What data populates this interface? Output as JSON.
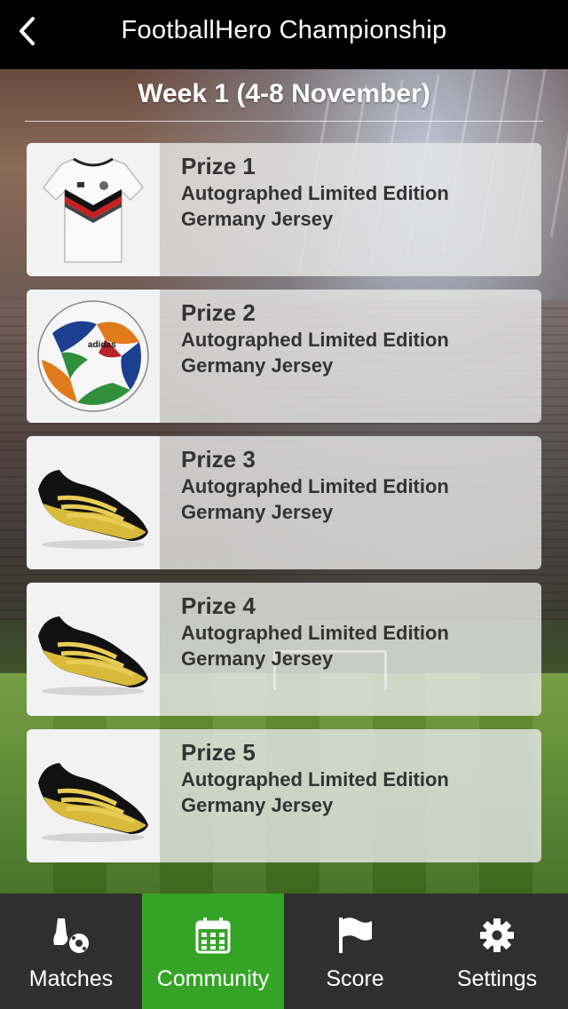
{
  "header": {
    "title": "FootballHero Championship",
    "back_icon": "chevron-left-icon"
  },
  "week": {
    "title": "Week 1 (4-8 November)"
  },
  "prizes": [
    {
      "name": "Prize 1",
      "description": "Autographed Limited Edition Germany Jersey",
      "image": "jersey"
    },
    {
      "name": "Prize 2",
      "description": "Autographed Limited Edition Germany Jersey",
      "image": "football"
    },
    {
      "name": "Prize 3",
      "description": "Autographed Limited Edition Germany Jersey",
      "image": "boot"
    },
    {
      "name": "Prize 4",
      "description": "Autographed Limited Edition Germany Jersey",
      "image": "boot"
    },
    {
      "name": "Prize 5",
      "description": "Autographed Limited Edition Germany Jersey",
      "image": "boot"
    }
  ],
  "tabs": [
    {
      "label": "Matches",
      "icon": "boot-ball-icon",
      "active": false
    },
    {
      "label": "Community",
      "icon": "calendar-icon",
      "active": true
    },
    {
      "label": "Score",
      "icon": "flag-icon",
      "active": false
    },
    {
      "label": "Settings",
      "icon": "gear-icon",
      "active": false
    }
  ],
  "colors": {
    "topbar": "#000000",
    "tab_active": "#35a426",
    "tabbar": "#2f2f2f"
  }
}
